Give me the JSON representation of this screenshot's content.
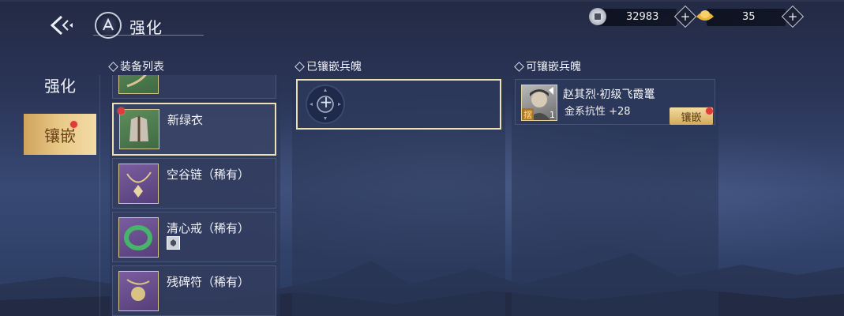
{
  "header": {
    "title": "强化",
    "back_icon": "back-arrow-icon",
    "emblem_icon": "strengthen-emblem-icon"
  },
  "currency": {
    "silver": {
      "icon": "silver-coin-icon",
      "value": "32983"
    },
    "gold": {
      "icon": "gold-ingot-icon",
      "value": "35"
    },
    "add_symbol": "+"
  },
  "tabs": [
    {
      "label": "强化",
      "active": false
    },
    {
      "label": "镶嵌",
      "active": true,
      "has_alert": true
    }
  ],
  "sections": {
    "equipment_list": "装备列表",
    "inlaid_gems": "已镶嵌兵魄",
    "available_gems": "可镶嵌兵魄"
  },
  "equipment": [
    {
      "name": "",
      "icon": "bow-icon",
      "rarity": "green"
    },
    {
      "name": "新绿衣",
      "icon": "armor-icon",
      "rarity": "green",
      "selected": true,
      "has_alert": true
    },
    {
      "name": "空谷链（稀有）",
      "icon": "necklace-icon",
      "rarity": "purple"
    },
    {
      "name": "清心戒（稀有）",
      "icon": "ring-icon",
      "rarity": "purple",
      "has_gem": true
    },
    {
      "name": "残碑符（稀有）",
      "icon": "talisman-icon",
      "rarity": "purple"
    }
  ],
  "inlaid_slot": {
    "icon": "empty-slot-plus-icon",
    "symbol": "+"
  },
  "available": [
    {
      "name": "赵其烈·初级飞霞鼍",
      "tag": "摆",
      "level": "1",
      "attr": "金系抗性 +28",
      "button": "镶嵌",
      "has_alert": true
    }
  ],
  "colors": {
    "accent_gold": "#e9c987",
    "alert_red": "#e03a3a",
    "purple_rarity": "#7a5d9f",
    "green_rarity": "#5f8d5c"
  }
}
